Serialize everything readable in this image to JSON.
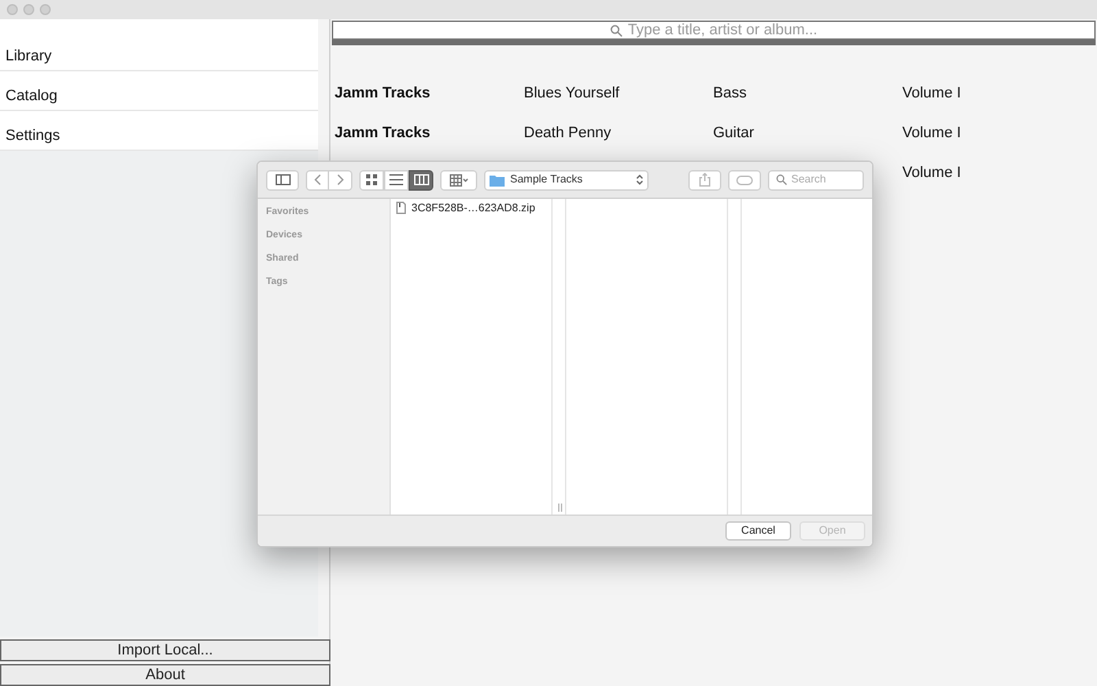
{
  "sidebar": {
    "items": [
      {
        "label": "Library"
      },
      {
        "label": "Catalog"
      },
      {
        "label": "Settings"
      }
    ],
    "buttons": [
      "Import Local...",
      "About"
    ]
  },
  "search": {
    "placeholder": "Type a title, artist or album..."
  },
  "table": {
    "rows": [
      {
        "column_1": "Jamm Tracks",
        "column_2": "Blues Yourself",
        "column_3": "Bass",
        "column_4": "Volume I"
      },
      {
        "column_1": "Jamm Tracks",
        "column_2": "Death Penny",
        "column_3": "Guitar",
        "column_4": "Volume I"
      },
      {
        "column_4": "Volume I"
      }
    ]
  },
  "dialog": {
    "view_modes": [
      {
        "kind": "icons",
        "selected": false
      },
      {
        "kind": "list",
        "selected": false
      },
      {
        "kind": "columns",
        "selected": true
      }
    ],
    "location": "Sample Tracks",
    "search_placeholder": "Search",
    "sidebar_sections": [
      "Favorites",
      "Devices",
      "Shared",
      "Tags"
    ],
    "files": [
      {
        "name": "3C8F528B-…623AD8.zip"
      }
    ],
    "buttons": [
      {
        "label": "Cancel",
        "disabled": false
      },
      {
        "label": "Open",
        "disabled": true
      }
    ]
  }
}
